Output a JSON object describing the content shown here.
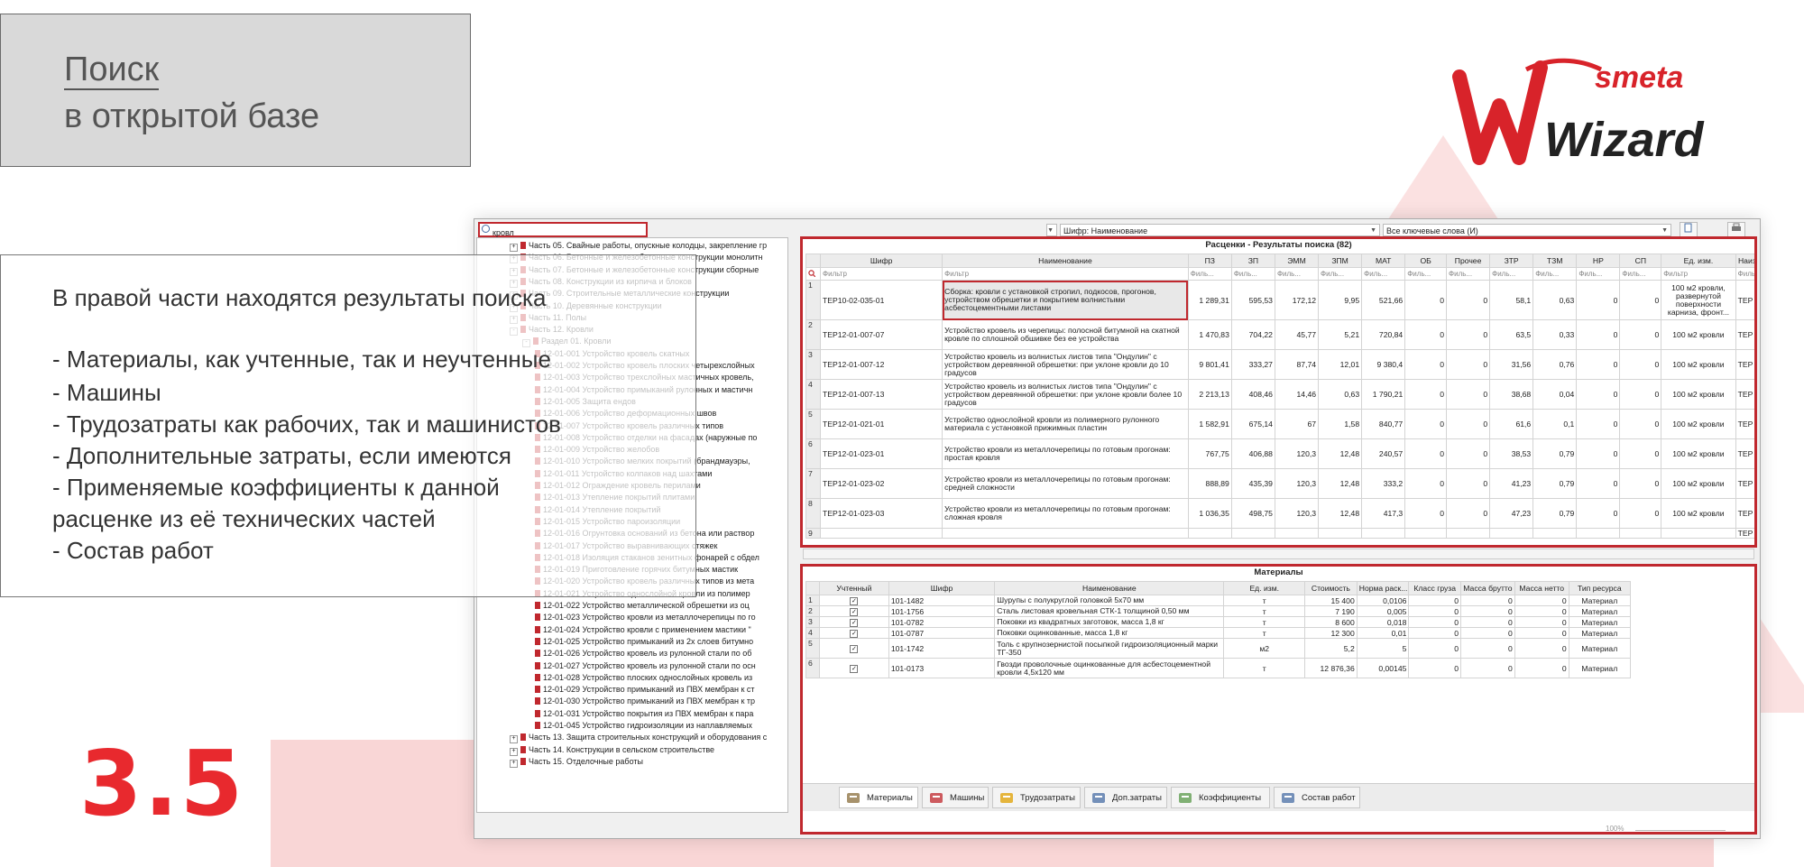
{
  "title": {
    "line1": "Поиск",
    "line2": "в открытой базе"
  },
  "logo": {
    "small": "smeta",
    "big": "Wizard"
  },
  "description": [
    "В правой части находятся результаты поиска",
    "",
    "- Материалы, как учтенные, так и неучтенные",
    "- Машины",
    "- Трудозатраты как рабочих, так и машинистов",
    "- Дополнительные затраты, если имеются",
    "- Применяемые коэффициенты к данной",
    "расценке из её технических частей",
    "- Состав работ"
  ],
  "slide_number": "3.5",
  "toolbar": {
    "search_value": "кровл",
    "cipher_combo": "Шифр: Наименование",
    "keywords_combo": "Все ключевые слова (И)"
  },
  "tree": [
    {
      "indent": 0,
      "exp": "+",
      "label": "Часть 05. Свайные работы, опускные колодцы, закрепление гр"
    },
    {
      "indent": 0,
      "exp": "+",
      "label": "Часть 06. Бетонные и железобетонные конструкции монолитн"
    },
    {
      "indent": 0,
      "exp": "+",
      "label": "Часть 07. Бетонные и железобетонные конструкции сборные"
    },
    {
      "indent": 0,
      "exp": "+",
      "label": "Часть 08. Конструкции из кирпича и блоков"
    },
    {
      "indent": 0,
      "exp": "+",
      "label": "Часть 09. Строительные металлические конструкции"
    },
    {
      "indent": 0,
      "exp": "+",
      "label": "Часть 10. Деревянные конструкции"
    },
    {
      "indent": 0,
      "exp": "+",
      "label": "Часть 11. Полы"
    },
    {
      "indent": 0,
      "exp": "-",
      "label": "Часть 12. Кровли"
    },
    {
      "indent": 1,
      "exp": "-",
      "label": "Раздел 01. Кровли"
    },
    {
      "indent": 2,
      "exp": "",
      "label": "12-01-001 Устройство кровель скатных"
    },
    {
      "indent": 2,
      "exp": "",
      "label": "12-01-002 Устройство кровель плоских четырехслойных"
    },
    {
      "indent": 2,
      "exp": "",
      "label": "12-01-003 Устройство трехслойных мастичных кровель,"
    },
    {
      "indent": 2,
      "exp": "",
      "label": "12-01-004 Устройство примыканий рулонных и мастичн"
    },
    {
      "indent": 2,
      "exp": "",
      "label": "12-01-005 Защита ендов"
    },
    {
      "indent": 2,
      "exp": "",
      "label": "12-01-006 Устройство деформационных швов"
    },
    {
      "indent": 2,
      "exp": "",
      "label": "12-01-007 Устройство кровель различных типов"
    },
    {
      "indent": 2,
      "exp": "",
      "label": "12-01-008 Устройство отделки на фасадах (наружные по"
    },
    {
      "indent": 2,
      "exp": "",
      "label": "12-01-009 Устройство желобов"
    },
    {
      "indent": 2,
      "exp": "",
      "label": "12-01-010 Устройство мелких покрытий (брандмауэры,"
    },
    {
      "indent": 2,
      "exp": "",
      "label": "12-01-011 Устройство колпаков над шахтами"
    },
    {
      "indent": 2,
      "exp": "",
      "label": "12-01-012 Ограждение кровель перилами"
    },
    {
      "indent": 2,
      "exp": "",
      "label": "12-01-013 Утепление покрытий плитами"
    },
    {
      "indent": 2,
      "exp": "",
      "label": "12-01-014 Утепление покрытий"
    },
    {
      "indent": 2,
      "exp": "",
      "label": "12-01-015 Устройство пароизоляции"
    },
    {
      "indent": 2,
      "exp": "",
      "label": "12-01-016 Огрунтовка оснований из бетона или раствор"
    },
    {
      "indent": 2,
      "exp": "",
      "label": "12-01-017 Устройство выравнивающих стяжек"
    },
    {
      "indent": 2,
      "exp": "",
      "label": "12-01-018 Изоляция стаканов зенитных фонарей с обдел"
    },
    {
      "indent": 2,
      "exp": "",
      "label": "12-01-019 Приготовление горячих битумных мастик"
    },
    {
      "indent": 2,
      "exp": "",
      "label": "12-01-020 Устройство кровель различных типов из мета"
    },
    {
      "indent": 2,
      "exp": "",
      "label": "12-01-021 Устройство однослойной кровли из полимер"
    },
    {
      "indent": 2,
      "exp": "",
      "label": "12-01-022 Устройство металлической обрешетки из оц"
    },
    {
      "indent": 2,
      "exp": "",
      "label": "12-01-023 Устройство кровли из металлочерепицы по го"
    },
    {
      "indent": 2,
      "exp": "",
      "label": "12-01-024 Устройство кровли с применением мастики \""
    },
    {
      "indent": 2,
      "exp": "",
      "label": "12-01-025 Устройство примыканий из 2х слоев битумно"
    },
    {
      "indent": 2,
      "exp": "",
      "label": "12-01-026 Устройство кровель из рулонной стали по об"
    },
    {
      "indent": 2,
      "exp": "",
      "label": "12-01-027 Устройство кровель из рулонной стали по осн"
    },
    {
      "indent": 2,
      "exp": "",
      "label": "12-01-028 Устройство плоских однослойных кровель из"
    },
    {
      "indent": 2,
      "exp": "",
      "label": "12-01-029 Устройство примыканий из ПВХ мембран к ст"
    },
    {
      "indent": 2,
      "exp": "",
      "label": "12-01-030 Устройство примыканий из ПВХ мембран к тр"
    },
    {
      "indent": 2,
      "exp": "",
      "label": "12-01-031 Устройство покрытия из ПВХ мембран к пара"
    },
    {
      "indent": 2,
      "exp": "",
      "label": "12-01-045 Устройство гидроизоляции из наплавляемых"
    },
    {
      "indent": 0,
      "exp": "+",
      "label": "Часть 13. Защита строительных конструкций и оборудования с"
    },
    {
      "indent": 0,
      "exp": "+",
      "label": "Часть 14. Конструкции в сельском строительстве"
    },
    {
      "indent": 0,
      "exp": "+",
      "label": "Часть 15. Отделочные работы"
    }
  ],
  "results": {
    "title": "Расценки - Результаты поиска (82)",
    "columns": [
      "Шифр",
      "Наименование",
      "ПЗ",
      "ЗП",
      "ЭММ",
      "ЗПМ",
      "МАТ",
      "ОБ",
      "Прочее",
      "ЗТР",
      "ТЗМ",
      "НР",
      "СП",
      "Ед. изм.",
      "Наиз"
    ],
    "filter_long": "Фильтр",
    "filter_short": "Филь...",
    "rows": [
      {
        "n": "1",
        "code": "ТЕР10-02-035-01",
        "name": "Сборка: кровли с установкой стропил, подкосов, прогонов, устройством обрешетки и покрытием волнистыми асбестоцементными листами",
        "v": [
          "1 289,31",
          "595,53",
          "172,12",
          "9,95",
          "521,66",
          "0",
          "0",
          "58,1",
          "0,63",
          "0",
          "0"
        ],
        "unit": "100 м2 кровли, развернутой поверхности карниза, фронт...",
        "last": "ТЕР"
      },
      {
        "n": "2",
        "code": "ТЕР12-01-007-07",
        "name": "Устройство кровель из черепицы: полосной битумной на скатной кровле по сплошной обшивке без ее устройства",
        "v": [
          "1 470,83",
          "704,22",
          "45,77",
          "5,21",
          "720,84",
          "0",
          "0",
          "63,5",
          "0,33",
          "0",
          "0"
        ],
        "unit": "100 м2 кровли",
        "last": "ТЕР"
      },
      {
        "n": "3",
        "code": "ТЕР12-01-007-12",
        "name": "Устройство кровель из волнистых листов типа \"Ондулин\" с устройством деревянной обрешетки: при уклоне кровли до 10 градусов",
        "v": [
          "9 801,41",
          "333,27",
          "87,74",
          "12,01",
          "9 380,4",
          "0",
          "0",
          "31,56",
          "0,76",
          "0",
          "0"
        ],
        "unit": "100 м2 кровли",
        "last": "ТЕР"
      },
      {
        "n": "4",
        "code": "ТЕР12-01-007-13",
        "name": "Устройство кровель из волнистых листов типа \"Ондулин\" с устройством деревянной обрешетки: при уклоне кровли более 10 градусов",
        "v": [
          "2 213,13",
          "408,46",
          "14,46",
          "0,63",
          "1 790,21",
          "0",
          "0",
          "38,68",
          "0,04",
          "0",
          "0"
        ],
        "unit": "100 м2 кровли",
        "last": "ТЕР"
      },
      {
        "n": "5",
        "code": "ТЕР12-01-021-01",
        "name": "Устройство однослойной кровли из полимерного рулонного материала с установкой прижимных пластин",
        "v": [
          "1 582,91",
          "675,14",
          "67",
          "1,58",
          "840,77",
          "0",
          "0",
          "61,6",
          "0,1",
          "0",
          "0"
        ],
        "unit": "100 м2 кровли",
        "last": "ТЕР"
      },
      {
        "n": "6",
        "code": "ТЕР12-01-023-01",
        "name": "Устройство кровли из металлочерепицы по готовым прогонам: простая кровля",
        "v": [
          "767,75",
          "406,88",
          "120,3",
          "12,48",
          "240,57",
          "0",
          "0",
          "38,53",
          "0,79",
          "0",
          "0"
        ],
        "unit": "100 м2 кровли",
        "last": "ТЕР"
      },
      {
        "n": "7",
        "code": "ТЕР12-01-023-02",
        "name": "Устройство кровли из металлочерепицы по готовым прогонам: средней сложности",
        "v": [
          "888,89",
          "435,39",
          "120,3",
          "12,48",
          "333,2",
          "0",
          "0",
          "41,23",
          "0,79",
          "0",
          "0"
        ],
        "unit": "100 м2 кровли",
        "last": "ТЕР"
      },
      {
        "n": "8",
        "code": "ТЕР12-01-023-03",
        "name": "Устройство кровли из металлочерепицы по готовым прогонам: сложная кровля",
        "v": [
          "1 036,35",
          "498,75",
          "120,3",
          "12,48",
          "417,3",
          "0",
          "0",
          "47,23",
          "0,79",
          "0",
          "0"
        ],
        "unit": "100 м2 кровли",
        "last": "ТЕР"
      },
      {
        "n": "9",
        "code": "",
        "name": "",
        "v": [
          "",
          "",
          "",
          "",
          "",
          "",
          "",
          "",
          "",
          "",
          ""
        ],
        "unit": "",
        "last": "ТЕР"
      }
    ]
  },
  "materials": {
    "title": "Материалы",
    "columns": [
      "Учтенный",
      "Шифр",
      "Наименование",
      "Ед. изм.",
      "Стоимость",
      "Норма раск...",
      "Класс груза",
      "Масса брутто",
      "Масса нетто",
      "Тип ресурса"
    ],
    "rows": [
      {
        "n": "1",
        "code": "101-1482",
        "name": "Шурупы с полукруглой головкой 5х70 мм",
        "unit": "т",
        "cost": "15 400",
        "norm": "0,0106",
        "cls": "0",
        "gross": "0",
        "net": "0",
        "type": "Материал"
      },
      {
        "n": "2",
        "code": "101-1756",
        "name": "Сталь листовая кровельная СТК-1 толщиной 0,50 мм",
        "unit": "т",
        "cost": "7 190",
        "norm": "0,005",
        "cls": "0",
        "gross": "0",
        "net": "0",
        "type": "Материал"
      },
      {
        "n": "3",
        "code": "101-0782",
        "name": "Поковки из квадратных заготовок, масса 1,8 кг",
        "unit": "т",
        "cost": "8 600",
        "norm": "0,018",
        "cls": "0",
        "gross": "0",
        "net": "0",
        "type": "Материал"
      },
      {
        "n": "4",
        "code": "101-0787",
        "name": "Поковки оцинкованные, масса 1,8 кг",
        "unit": "т",
        "cost": "12 300",
        "norm": "0,01",
        "cls": "0",
        "gross": "0",
        "net": "0",
        "type": "Материал"
      },
      {
        "n": "5",
        "code": "101-1742",
        "name": "Толь с крупнозернистой посыпкой гидроизоляционный марки ТГ-350",
        "unit": "м2",
        "cost": "5,2",
        "norm": "5",
        "cls": "0",
        "gross": "0",
        "net": "0",
        "type": "Материал"
      },
      {
        "n": "6",
        "code": "101-0173",
        "name": "Гвозди проволочные оцинкованные для асбестоцементной кровли 4,5х120 мм",
        "unit": "т",
        "cost": "12 876,36",
        "norm": "0,00145",
        "cls": "0",
        "gross": "0",
        "net": "0",
        "type": "Материал"
      }
    ],
    "tabs": [
      "Материалы",
      "Машины",
      "Трудозатраты",
      "Доп.затраты",
      "Коэффициенты",
      "Состав работ"
    ]
  },
  "statusbar": {
    "zoom": "100%"
  },
  "colors": {
    "accent": "#c0282e",
    "number": "#e8292e"
  }
}
